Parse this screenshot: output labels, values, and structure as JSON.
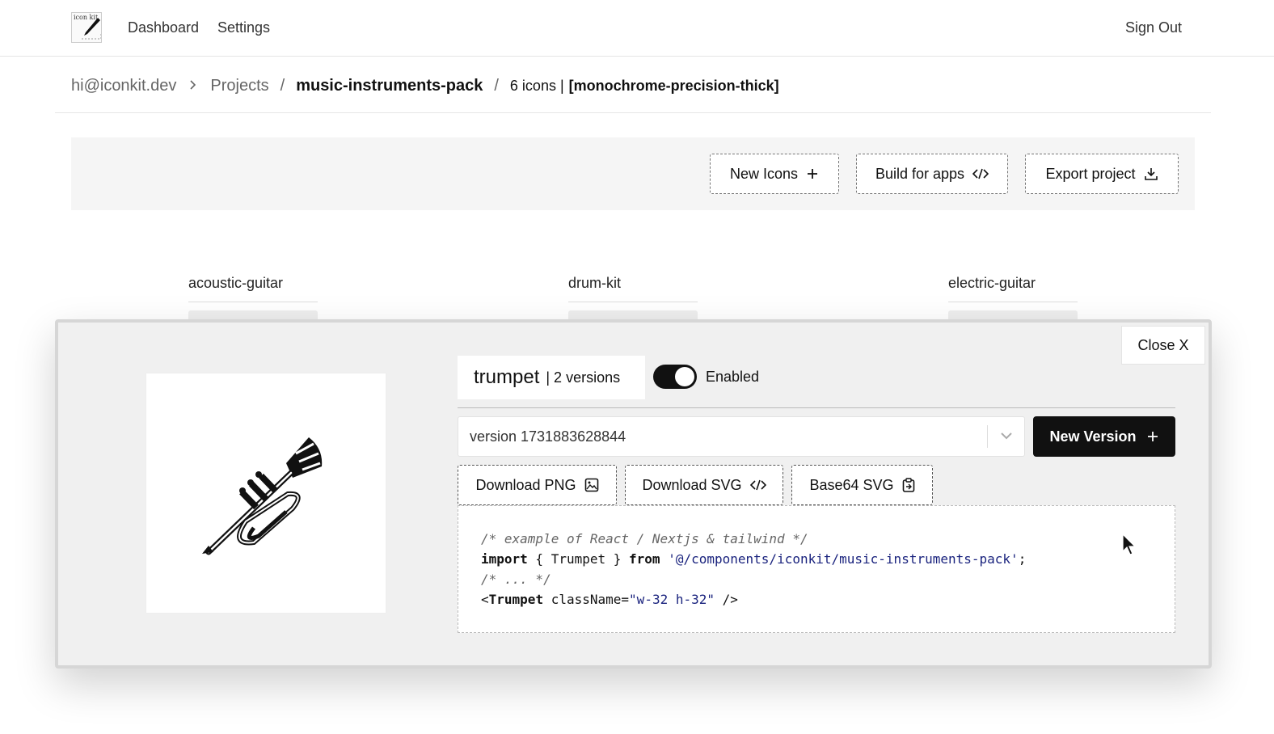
{
  "nav": {
    "logo_text": "icon kit",
    "links": [
      "Dashboard",
      "Settings"
    ],
    "sign_out": "Sign Out"
  },
  "breadcrumb": {
    "user": "hi@iconkit.dev",
    "separator": ">",
    "projects": "Projects",
    "slash": "/",
    "pack": "music-instruments-pack",
    "count": "6 icons |",
    "style": "[monochrome-precision-thick]"
  },
  "toolbar": {
    "new_icons": "New Icons",
    "build": "Build for apps",
    "export": "Export project"
  },
  "grid": {
    "items": [
      "acoustic-guitar",
      "drum-kit",
      "electric-guitar"
    ]
  },
  "modal": {
    "close": "Close X",
    "icon_name": "trumpet",
    "versions": "| 2 versions",
    "toggle_label": "Enabled",
    "toggle_on": true,
    "version_value": "version 1731883628844",
    "new_version": "New Version",
    "download_png": "Download PNG",
    "download_svg": "Download SVG",
    "base64_svg": "Base64 SVG",
    "code": {
      "line1": "/* example of React / Nextjs & tailwind */",
      "line2_kw1": "import",
      "line2_mid": " { Trumpet } ",
      "line2_kw2": "from",
      "line2_str": "'@/components/iconkit/music-instruments-pack'",
      "line2_end": ";",
      "line3": "/* ... */",
      "line4_open": "<",
      "line4_tag": "Trumpet",
      "line4_attr": " className=",
      "line4_str": "\"w-32 h-32\"",
      "line4_close": " />"
    }
  },
  "colors": {
    "primary": "#111111",
    "muted": "#666666",
    "string": "#1a237e",
    "panel": "#f0f0f0"
  }
}
